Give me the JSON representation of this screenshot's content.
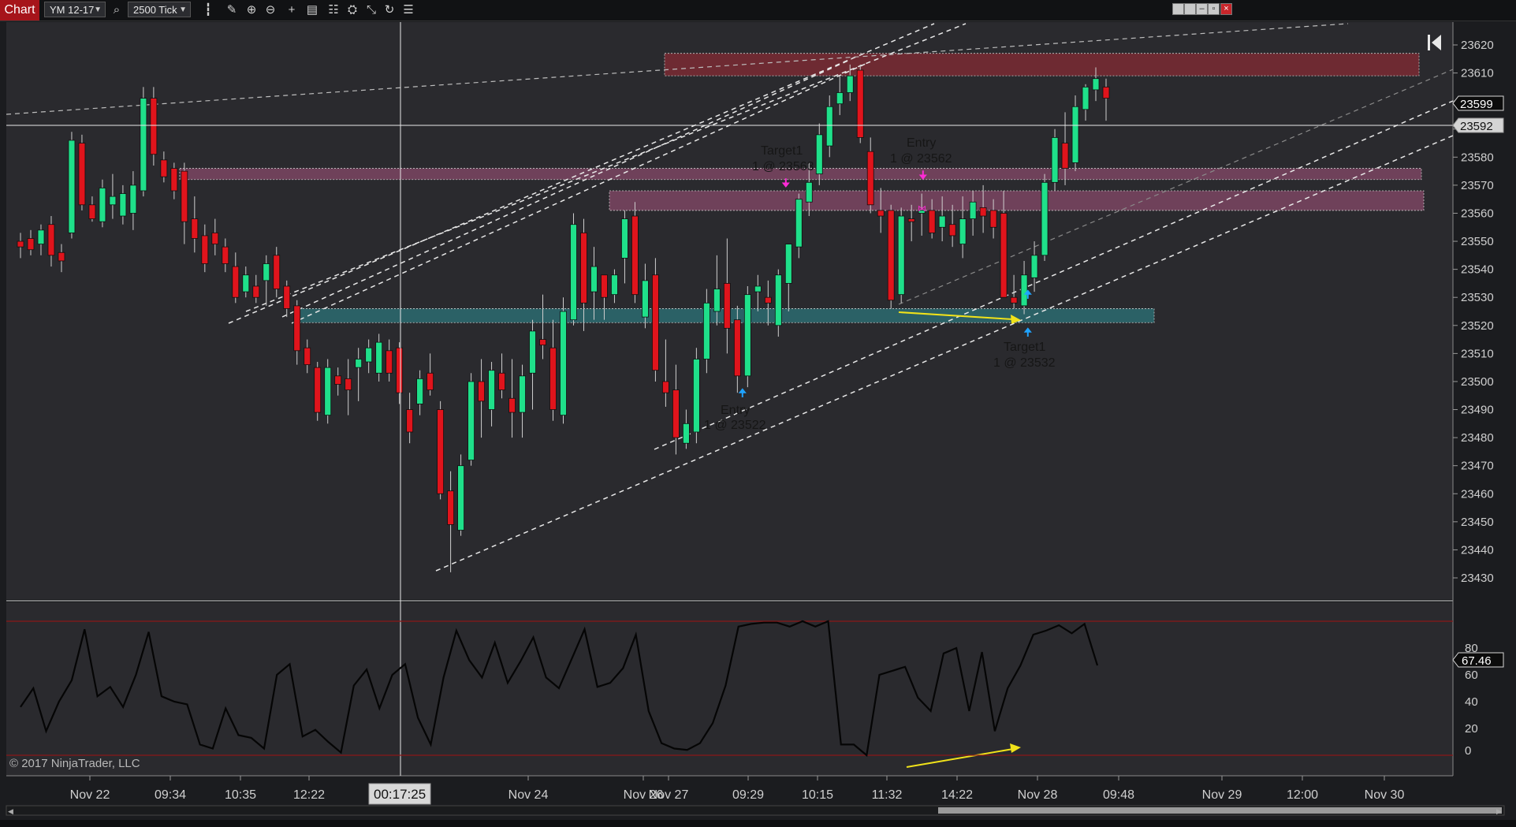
{
  "toolbar": {
    "tab": "Chart",
    "instrument": "YM 12-17",
    "interval": "2500 Tick",
    "icons": [
      "search-icon",
      "bars-style-icon",
      "pencil-icon",
      "zoom-in-icon",
      "zoom-out-icon",
      "crosshair-icon",
      "properties-icon",
      "indicators-icon",
      "strategies-icon",
      "drawing-tools-icon",
      "reload-icon",
      "data-box-icon"
    ]
  },
  "window_controls": [
    "tile-icon",
    "restore-icon",
    "minimize-icon",
    "maximize-icon",
    "close-icon"
  ],
  "colors": {
    "background": "#2a2a2e",
    "up_candle": "#1fe08a",
    "down_candle": "#e0141c",
    "resistance_zone": "#7a2a33",
    "supply_zone": "#7b4561",
    "support_zone": "#2c6b70",
    "divergence_arrow": "#f0e21a",
    "entry_marker_buy": "#1fa3ff",
    "entry_marker_sell": "#ff2bd6"
  },
  "price_axis": {
    "ticks": [
      "23620",
      "23610",
      "23600",
      "23590",
      "23580",
      "23570",
      "23560",
      "23550",
      "23540",
      "23530",
      "23520",
      "23510",
      "23500",
      "23490",
      "23480",
      "23470",
      "23460",
      "23450",
      "23440",
      "23430"
    ],
    "last_price": "23599",
    "crosshair_price": "23592"
  },
  "time_axis": {
    "labels": [
      "Nov 22",
      "09:34",
      "10:35",
      "12:22",
      "Nov 24",
      "Nov 26",
      "Nov 27",
      "09:29",
      "10:15",
      "11:32",
      "14:22",
      "Nov 28",
      "09:48",
      "Nov 29",
      "12:00",
      "Nov 30"
    ],
    "crosshair_time": "00:17:25"
  },
  "annotations": {
    "target1_top_title": "Target1",
    "target1_top_detail": "1 @ 23563",
    "entry_top_title": "Entry",
    "entry_top_detail": "1 @ 23562",
    "entry_bottom_title": "Entry",
    "entry_bottom_detail": "1 @ 23522",
    "target1_bottom_title": "Target1",
    "target1_bottom_detail": "1 @ 23532"
  },
  "oscillator": {
    "ticks": [
      "80",
      "60",
      "40",
      "20",
      "0"
    ],
    "current_value": "67.46"
  },
  "copyright": "© 2017 NinjaTrader, LLC",
  "chart_data": {
    "type": "candlestick",
    "instrument": "YM 12-17",
    "interval": "2500 Tick",
    "ylim": [
      23425,
      23626
    ],
    "candles": [
      [
        23550,
        23553,
        23544,
        23548
      ],
      [
        23551,
        23554,
        23545,
        23547
      ],
      [
        23549,
        23556,
        23545,
        23554
      ],
      [
        23556,
        23559,
        23541,
        23545
      ],
      [
        23546,
        23549,
        23539,
        23543
      ],
      [
        23553,
        23589,
        23551,
        23586
      ],
      [
        23585,
        23588,
        23561,
        23563
      ],
      [
        23563,
        23566,
        23557,
        23558
      ],
      [
        23557,
        23572,
        23555,
        23569
      ],
      [
        23563,
        23574,
        23558,
        23566
      ],
      [
        23559,
        23570,
        23556,
        23567
      ],
      [
        23560,
        23575,
        23554,
        23570
      ],
      [
        23568,
        23605,
        23566,
        23601
      ],
      [
        23601,
        23605,
        23577,
        23581
      ],
      [
        23579,
        23582,
        23571,
        23573
      ],
      [
        23576,
        23578,
        23565,
        23568
      ],
      [
        23575,
        23578,
        23549,
        23557
      ],
      [
        23558,
        23566,
        23546,
        23551
      ],
      [
        23552,
        23556,
        23539,
        23542
      ],
      [
        23553,
        23558,
        23545,
        23549
      ],
      [
        23548,
        23551,
        23539,
        23542
      ],
      [
        23541,
        23546,
        23528,
        23530
      ],
      [
        23532,
        23541,
        23530,
        23538
      ],
      [
        23534,
        23538,
        23528,
        23530
      ],
      [
        23536,
        23545,
        23527,
        23542
      ],
      [
        23545,
        23548,
        23530,
        23533
      ],
      [
        23534,
        23536,
        23523,
        23526
      ],
      [
        23527,
        23529,
        23506,
        23511
      ],
      [
        23512,
        23515,
        23503,
        23506
      ],
      [
        23505,
        23507,
        23486,
        23489
      ],
      [
        23488,
        23508,
        23485,
        23505
      ],
      [
        23502,
        23505,
        23495,
        23499
      ],
      [
        23501,
        23508,
        23488,
        23497
      ],
      [
        23505,
        23512,
        23493,
        23508
      ],
      [
        23507,
        23515,
        23503,
        23512
      ],
      [
        23503,
        23517,
        23500,
        23514
      ],
      [
        23511,
        23515,
        23500,
        23503
      ],
      [
        23512,
        23514,
        23492,
        23496
      ],
      [
        23490,
        23496,
        23478,
        23482
      ],
      [
        23492,
        23504,
        23488,
        23501
      ],
      [
        23503,
        23510,
        23495,
        23497
      ],
      [
        23490,
        23493,
        23458,
        23460
      ],
      [
        23461,
        23468,
        23432,
        23449
      ],
      [
        23447,
        23474,
        23445,
        23470
      ],
      [
        23472,
        23503,
        23470,
        23500
      ],
      [
        23500,
        23508,
        23480,
        23493
      ],
      [
        23490,
        23507,
        23484,
        23504
      ],
      [
        23503,
        23510,
        23494,
        23497
      ],
      [
        23494,
        23508,
        23480,
        23489
      ],
      [
        23489,
        23506,
        23480,
        23502
      ],
      [
        23503,
        23522,
        23490,
        23518
      ],
      [
        23515,
        23531,
        23508,
        23513
      ],
      [
        23512,
        23522,
        23486,
        23490
      ],
      [
        23488,
        23530,
        23485,
        23525
      ],
      [
        23522,
        23560,
        23520,
        23556
      ],
      [
        23553,
        23558,
        23518,
        23528
      ],
      [
        23532,
        23548,
        23522,
        23541
      ],
      [
        23538,
        23535,
        23522,
        23530
      ],
      [
        23531,
        23540,
        23528,
        23538
      ],
      [
        23544,
        23561,
        23535,
        23558
      ],
      [
        23559,
        23564,
        23528,
        23531
      ],
      [
        23523,
        23542,
        23519,
        23536
      ],
      [
        23538,
        23544,
        23500,
        23504
      ],
      [
        23500,
        23515,
        23491,
        23496
      ],
      [
        23497,
        23506,
        23474,
        23480
      ],
      [
        23478,
        23490,
        23476,
        23485
      ],
      [
        23482,
        23512,
        23478,
        23508
      ],
      [
        23508,
        23533,
        23503,
        23528
      ],
      [
        23525,
        23545,
        23520,
        23533
      ],
      [
        23535,
        23551,
        23510,
        23519
      ],
      [
        23522,
        23527,
        23496,
        23502
      ],
      [
        23502,
        23534,
        23498,
        23531
      ],
      [
        23532,
        23538,
        23525,
        23534
      ],
      [
        23530,
        23536,
        23520,
        23528
      ],
      [
        23520,
        23540,
        23516,
        23538
      ],
      [
        23535,
        23546,
        23525,
        23549
      ],
      [
        23548,
        23567,
        23544,
        23565
      ],
      [
        23564,
        23578,
        23559,
        23571
      ],
      [
        23574,
        23592,
        23570,
        23588
      ],
      [
        23584,
        23602,
        23580,
        23598
      ],
      [
        23599,
        23609,
        23595,
        23603
      ],
      [
        23603,
        23613,
        23600,
        23609
      ],
      [
        23611,
        23613,
        23585,
        23587
      ],
      [
        23582,
        23587,
        23560,
        23563
      ],
      [
        23561,
        23569,
        23553,
        23559
      ],
      [
        23561,
        23563,
        23526,
        23529
      ],
      [
        23531,
        23562,
        23528,
        23559
      ],
      [
        23558,
        23563,
        23550,
        23557
      ],
      [
        23560,
        23567,
        23552,
        23561
      ],
      [
        23561,
        23565,
        23551,
        23553
      ],
      [
        23555,
        23566,
        23550,
        23559
      ],
      [
        23556,
        23563,
        23548,
        23552
      ],
      [
        23549,
        23566,
        23544,
        23558
      ],
      [
        23558,
        23568,
        23552,
        23564
      ],
      [
        23562,
        23570,
        23553,
        23559
      ],
      [
        23561,
        23565,
        23551,
        23555
      ],
      [
        23560,
        23568,
        23538,
        23530
      ],
      [
        23530,
        23538,
        23526,
        23528
      ],
      [
        23527,
        23543,
        23524,
        23538
      ],
      [
        23537,
        23550,
        23532,
        23545
      ],
      [
        23545,
        23574,
        23543,
        23571
      ],
      [
        23571,
        23590,
        23568,
        23587
      ],
      [
        23585,
        23596,
        23570,
        23576
      ],
      [
        23578,
        23602,
        23575,
        23598
      ],
      [
        23597,
        23606,
        23593,
        23605
      ],
      [
        23604,
        23612,
        23600,
        23608
      ],
      [
        23605,
        23608,
        23593,
        23601
      ]
    ],
    "zones": [
      {
        "kind": "resistance",
        "from": 23617,
        "to": 23609
      },
      {
        "kind": "supply",
        "from": 23576,
        "to": 23572
      },
      {
        "kind": "supply",
        "from": 23568,
        "to": 23561
      },
      {
        "kind": "support",
        "from": 23526,
        "to": 23521
      }
    ],
    "oscillator_values": [
      36,
      50,
      18,
      40,
      56,
      94,
      44,
      51,
      36,
      60,
      92,
      44,
      40,
      38,
      8,
      5,
      35,
      15,
      13,
      5,
      60,
      68,
      14,
      19,
      10,
      2,
      52,
      64,
      35,
      60,
      68,
      28,
      8,
      58,
      93,
      71,
      58,
      84,
      54,
      70,
      88,
      58,
      50,
      72,
      94,
      51,
      54,
      65,
      90,
      33,
      9,
      5,
      4,
      9,
      24,
      52,
      96,
      98,
      99,
      99,
      96,
      100,
      96,
      100,
      8,
      8,
      0,
      60,
      63,
      66,
      43,
      33,
      76,
      80,
      33,
      77,
      18,
      50,
      67,
      90,
      93,
      97,
      91,
      98,
      67
    ]
  }
}
